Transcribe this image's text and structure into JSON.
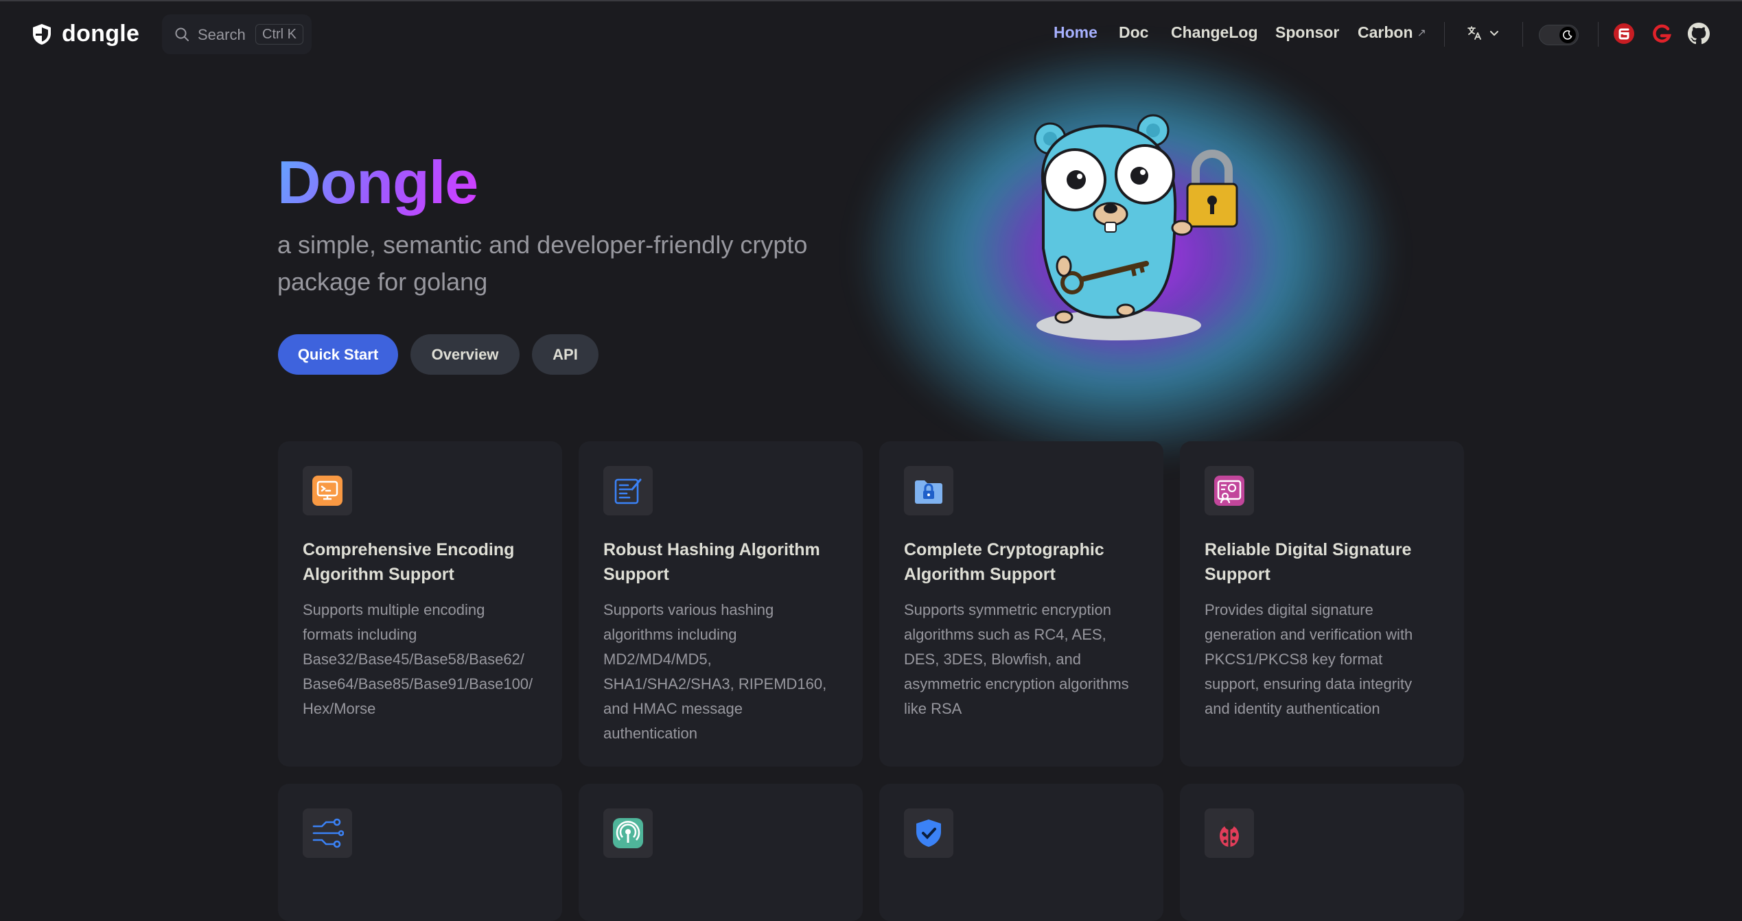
{
  "nav": {
    "brand": "dongle",
    "search_label": "Search",
    "search_shortcut": "Ctrl K",
    "links": [
      {
        "label": "Home",
        "active": true
      },
      {
        "label": "Doc"
      },
      {
        "label": "ChangeLog"
      },
      {
        "label": "Sponsor"
      },
      {
        "label": "Carbon",
        "external": true
      }
    ],
    "language_icon": "translate-icon",
    "theme_icon": "moon-icon",
    "social_icons": [
      "gitee-icon",
      "gitcode-icon",
      "github-icon"
    ]
  },
  "hero": {
    "title": "Dongle",
    "tagline": "a simple, semantic and developer-friendly crypto package for golang",
    "actions": [
      {
        "label": "Quick Start"
      },
      {
        "label": "Overview"
      },
      {
        "label": "API"
      }
    ]
  },
  "features": [
    {
      "icon": "encoding-terminal-icon",
      "title": "Comprehensive Encoding Algorithm Support",
      "desc": "Supports multiple encoding formats including Base32/Base45/Base58/Base62/ Base64/Base85/Base91/Base100/ Hex/Morse"
    },
    {
      "icon": "hashing-document-icon",
      "title": "Robust Hashing Algorithm Support",
      "desc": "Supports various hashing algorithms including MD2/MD4/MD5, SHA1/SHA2/SHA3, RIPEMD160, and HMAC message authentication"
    },
    {
      "icon": "lock-folder-icon",
      "title": "Complete Cryptographic Algorithm Support",
      "desc": "Supports symmetric encryption algorithms such as RC4, AES, DES, 3DES, Blowfish, and asymmetric encryption algorithms like RSA"
    },
    {
      "icon": "certificate-icon",
      "title": "Reliable Digital Signature Support",
      "desc": "Provides digital signature generation and verification with PKCS1/PKCS8 key format support, ensuring data integrity and identity authentication"
    },
    {
      "icon": "circuit-icon",
      "title": "",
      "desc": ""
    },
    {
      "icon": "broadcast-icon",
      "title": "",
      "desc": ""
    },
    {
      "icon": "shield-check-icon",
      "title": "",
      "desc": ""
    },
    {
      "icon": "bug-icon",
      "title": "",
      "desc": ""
    }
  ],
  "colors": {
    "background": "#1b1b1f",
    "card": "#202127",
    "primary_button": "#3e63dd",
    "active_link": "#a8b1ff",
    "title_gradient_start": "#5fa9ff",
    "title_gradient_end": "#d63bff"
  }
}
